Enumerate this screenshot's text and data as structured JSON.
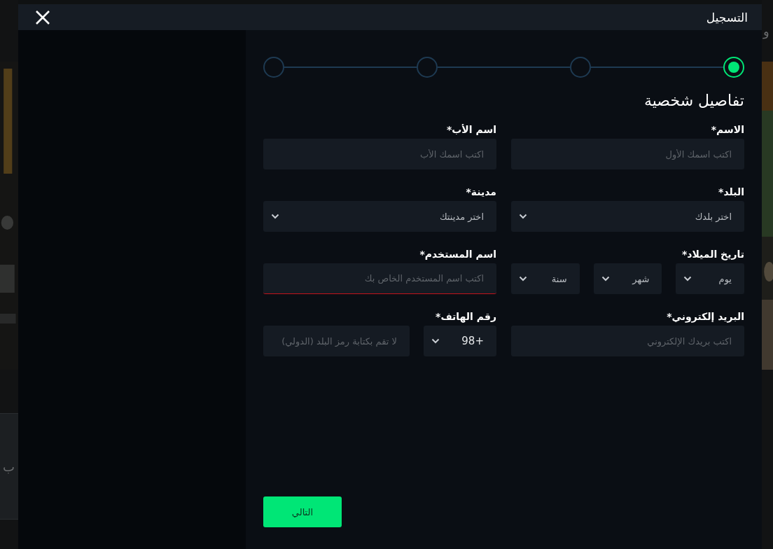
{
  "background_right_text": "و",
  "background_left_text": "ب",
  "window": {
    "title": "التسجيل"
  },
  "steps": [
    {
      "selected": true
    },
    {
      "selected": false
    },
    {
      "selected": false
    },
    {
      "selected": false
    }
  ],
  "section_title": "تفاصيل شخصية",
  "fields": [
    {
      "kind": "text",
      "label": "الاسم*",
      "placeholder": "اكتب اسمك الأول"
    },
    {
      "kind": "text",
      "label": "اسم الأب*",
      "placeholder": "اكتب اسمك الأب"
    },
    {
      "kind": "select",
      "label": "البلد*",
      "value": "اختر بلدك"
    },
    {
      "kind": "select",
      "label": "مدينة*",
      "value": "اختر مدينتك"
    },
    {
      "kind": "date",
      "label": "تاريخ الميلاد*",
      "parts": [
        "يوم",
        "شهر",
        "سنة"
      ]
    },
    {
      "kind": "text",
      "label": "اسم المستخدم*",
      "placeholder": "اكتب اسم المستخدم الخاص بك",
      "error": true
    },
    {
      "kind": "text",
      "label": "البريد إلكتروني*",
      "placeholder": "اكتب بريدك الإلكتروني"
    },
    {
      "kind": "phone",
      "label": "رقم الهاتف*",
      "code": "+98",
      "placeholder": "لا تقم بكتابة رمز البلد (الدولي)"
    }
  ],
  "next_button": "التالي"
}
